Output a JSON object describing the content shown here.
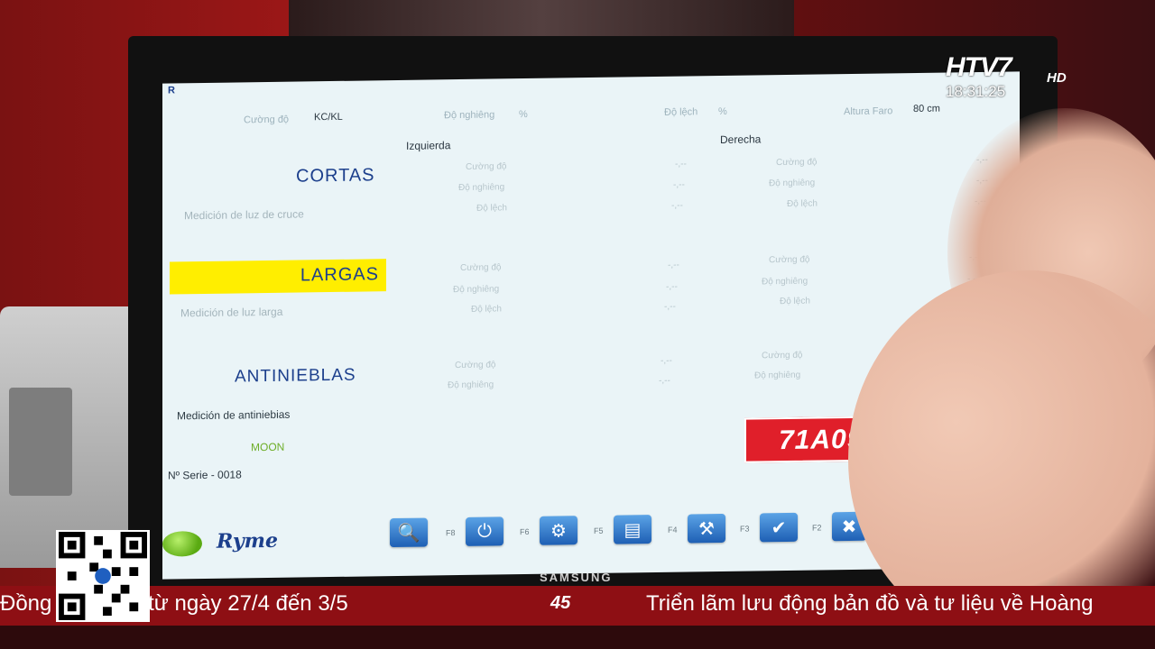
{
  "screen": {
    "corner_letter": "R",
    "header": {
      "cuong_do_label": "Cường độ",
      "cuong_do_unit": "KC/KL",
      "do_nghieng_label": "Độ nghiêng",
      "do_nghieng_unit": "%",
      "do_lech_label": "Độ lệch",
      "do_lech_unit": "%",
      "altura_label": "Altura Faro",
      "altura_value": "80 cm"
    },
    "col_left": "Izquierda",
    "col_right": "Derecha",
    "cortas": {
      "title": "CORTAS",
      "check": "Medición de luz de cruce",
      "rows": [
        "Cường độ",
        "Độ nghiêng",
        "Độ lệch"
      ],
      "left_vals": [
        "-,--",
        "-,--",
        "-,--"
      ],
      "right_vals": [
        "-,--",
        "-,--",
        "-,--"
      ]
    },
    "largas": {
      "title": "LARGAS",
      "check": "Medición de luz larga",
      "rows": [
        "Cường độ",
        "Độ nghiêng",
        "Độ lệch"
      ],
      "left_vals": [
        "-,--",
        "-,--",
        "-,--"
      ],
      "right_vals": [
        "-,--",
        "-,--",
        "-,--"
      ]
    },
    "antinieblas": {
      "title": "ANTINIEBLAS",
      "check": "Medición de antiniebias",
      "rows": [
        "Cường độ",
        "Độ nghiêng"
      ],
      "left_vals": [
        "-,--",
        "-,--"
      ],
      "right_vals": [
        "-,--",
        "-,--"
      ]
    },
    "moon_label": "MOON",
    "serie": "Nº Serie - 0018",
    "brand": "Ryme",
    "plate": "71A09587T",
    "toolbar": [
      {
        "icon": "search-icon",
        "key": "F8",
        "glyph": "🔍"
      },
      {
        "icon": "power-icon",
        "key": "F6",
        "glyph": "⏻"
      },
      {
        "icon": "gear-icon",
        "key": "F5",
        "glyph": "⚙"
      },
      {
        "icon": "printer-icon",
        "key": "F4",
        "glyph": "▤"
      },
      {
        "icon": "tools-icon",
        "key": "F3",
        "glyph": "⚒"
      },
      {
        "icon": "check-icon",
        "key": "F2",
        "glyph": "✔"
      },
      {
        "icon": "close-icon",
        "key": "",
        "glyph": "✖"
      }
    ]
  },
  "monitor_brand": "SAMSUNG",
  "tv": {
    "channel": "HTV7",
    "hd": "HD",
    "time": "18:31:25",
    "ticker_left": "Đồng 2 diễn ra từ ngày 27/4 đến 3/5",
    "ticker_badge": "45",
    "ticker_right": "Triển lãm lưu động bản đồ và tư liệu về Hoàng"
  },
  "colors": {
    "highlight_yellow": "#ffee00",
    "plate_red": "#e01f2a",
    "title_blue": "#1c3f8c",
    "moon_green": "#6fae2a",
    "ticker_red": "#8e0f14"
  }
}
